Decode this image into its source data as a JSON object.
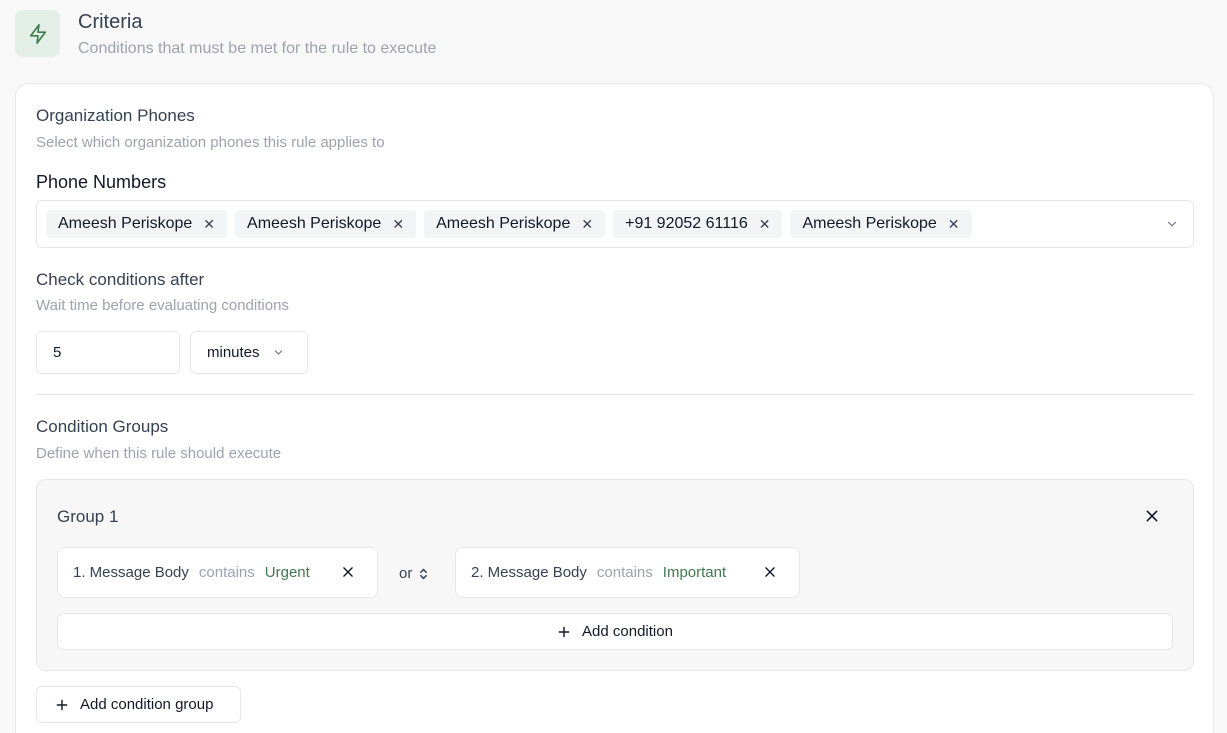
{
  "header": {
    "icon": "lightning-icon",
    "title": "Criteria",
    "subtitle": "Conditions that must be met for the rule to execute",
    "accent_color": "#3f7a4f"
  },
  "org_phones": {
    "title": "Organization Phones",
    "subtitle": "Select which organization phones this rule applies to",
    "field_label": "Phone Numbers",
    "chips": [
      {
        "label": "Ameesh Periskope"
      },
      {
        "label": "Ameesh Periskope"
      },
      {
        "label": "Ameesh Periskope"
      },
      {
        "label": "+91 92052 61116"
      },
      {
        "label": "Ameesh Periskope"
      }
    ],
    "chip_remove_glyph": "✕"
  },
  "check_after": {
    "title": "Check conditions after",
    "subtitle": "Wait time before evaluating conditions",
    "value": "5",
    "unit": "minutes"
  },
  "condition_groups": {
    "title": "Condition Groups",
    "subtitle": "Define when this rule should execute",
    "groups": [
      {
        "title": "Group 1",
        "conditions": [
          {
            "field": "1. Message Body",
            "operator": "contains",
            "value": "Urgent"
          },
          {
            "field": "2. Message Body",
            "operator": "contains",
            "value": "Important"
          }
        ],
        "connector": "or",
        "add_condition_label": "Add condition"
      }
    ],
    "add_group_label": "Add condition group"
  }
}
